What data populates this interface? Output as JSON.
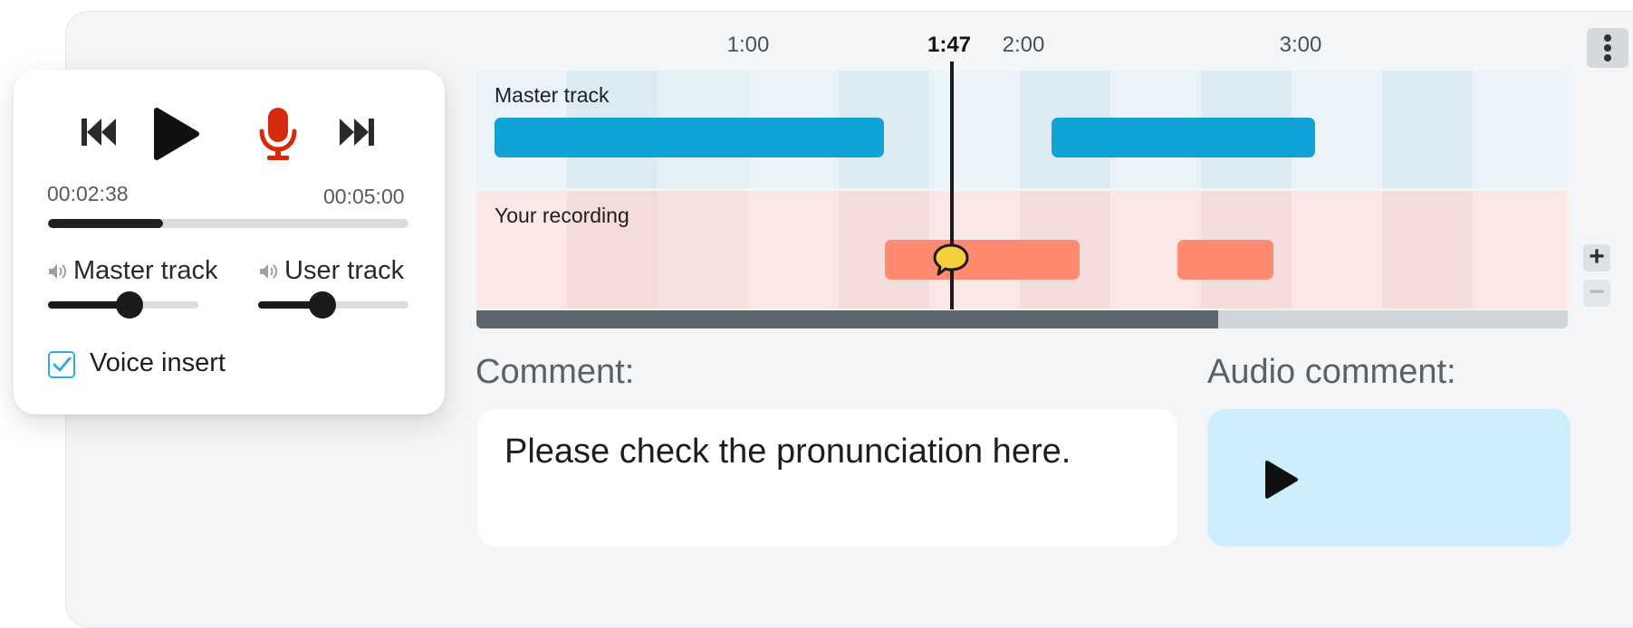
{
  "timeline": {
    "ticks": [
      "1:00",
      "2:00",
      "3:00"
    ],
    "current_time": "1:47",
    "tracks": [
      {
        "label": "Master track"
      },
      {
        "label": "Your recording"
      }
    ],
    "scroll_fraction": 0.68
  },
  "player": {
    "elapsed": "00:02:38",
    "total": "00:05:00",
    "progress_fraction": 0.32,
    "master_volume_label": "Master track",
    "master_volume_fraction": 0.54,
    "user_volume_label": "User track",
    "user_volume_fraction": 0.43,
    "voice_insert_label": "Voice insert",
    "voice_insert_checked": true,
    "icons": [
      "skip-back-icon",
      "play-icon",
      "microphone-icon",
      "skip-forward-icon",
      "speaker-icon"
    ]
  },
  "comment": {
    "label": "Comment:",
    "text": "Please check the pronunciation here."
  },
  "audio_comment": {
    "label": "Audio comment:"
  },
  "colors": {
    "master_clip": "#0ea2d6",
    "user_clip": "#ff8a70",
    "record_red": "#d62a0d",
    "accent_blue": "#34abe0",
    "audio_box": "#cdeefc"
  }
}
